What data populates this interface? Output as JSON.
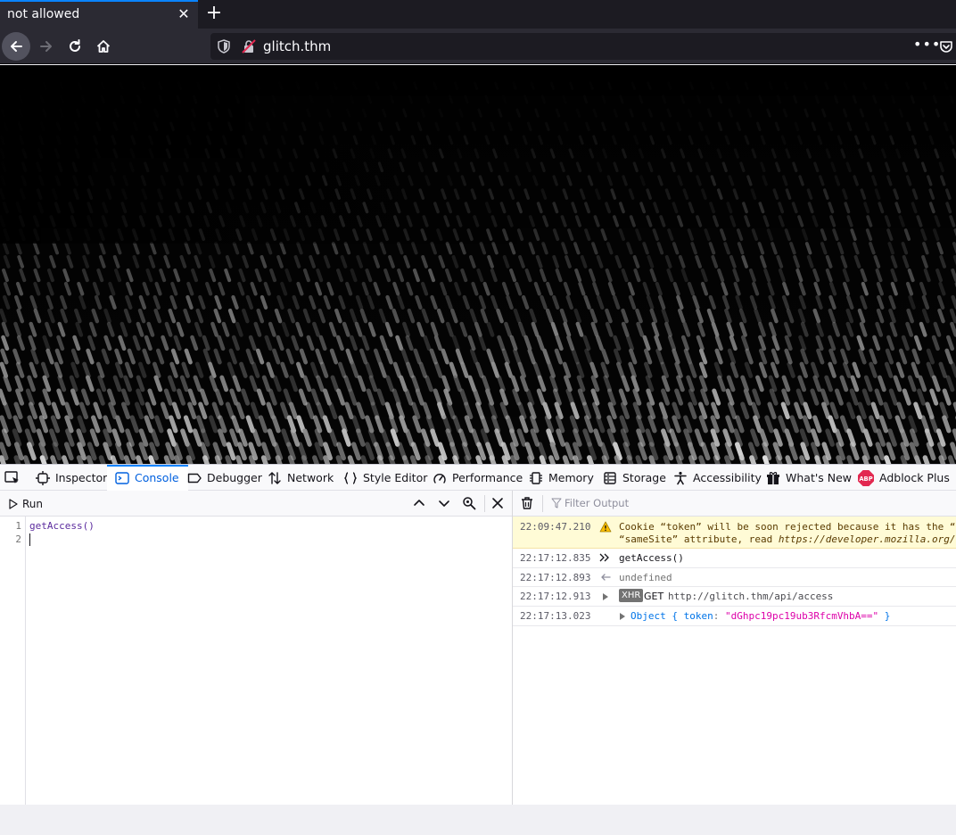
{
  "tab": {
    "title": "not allowed",
    "close_glyph": "✕",
    "new_tab_glyph": "+"
  },
  "navbar": {
    "url": "glitch.thm",
    "more_glyph": "•••"
  },
  "devtools": {
    "tabs": [
      {
        "label": "Inspector",
        "icon": "inspector-icon"
      },
      {
        "label": "Console",
        "icon": "console-icon"
      },
      {
        "label": "Debugger",
        "icon": "debugger-icon"
      },
      {
        "label": "Network",
        "icon": "network-icon"
      },
      {
        "label": "Style Editor",
        "icon": "style-editor-icon"
      },
      {
        "label": "Performance",
        "icon": "performance-icon"
      },
      {
        "label": "Memory",
        "icon": "memory-icon"
      },
      {
        "label": "Storage",
        "icon": "storage-icon"
      },
      {
        "label": "Accessibility",
        "icon": "accessibility-icon"
      },
      {
        "label": "What's New",
        "icon": "gift-icon"
      },
      {
        "label": "Adblock Plus",
        "icon": "abp-icon"
      }
    ],
    "active_tab": "Console",
    "editor": {
      "run_label": "Run",
      "lines": [
        "1",
        "2"
      ],
      "code": [
        "getAccess()",
        ""
      ]
    },
    "console": {
      "filter_placeholder": "Filter Output",
      "messages": [
        {
          "kind": "warning",
          "time": "22:09:47.210",
          "text": "Cookie “token” will be soon rejected because it has the “",
          "text2_prefix": "“sameSite” attribute, read ",
          "text2_link": "https://developer.mozilla.org/"
        },
        {
          "kind": "input",
          "time": "22:17:12.835",
          "text": "getAccess()"
        },
        {
          "kind": "output",
          "time": "22:17:12.893",
          "text": "undefined"
        },
        {
          "kind": "xhr",
          "time": "22:17:12.913",
          "badge": "XHR",
          "method": "GET",
          "url": "http://glitch.thm/api/access"
        },
        {
          "kind": "object",
          "time": "22:17:13.023",
          "open": "Object { ",
          "key": "token",
          "colon": ": ",
          "value": "\"dGhpc19pc19ub3RfcmVhbA==\"",
          "close": " }"
        }
      ]
    }
  },
  "colors": {
    "accent": "#0a84ff",
    "active_tab_text": "#0060df",
    "warning_bg": "#fffbd6",
    "string": "#dd00a9"
  }
}
